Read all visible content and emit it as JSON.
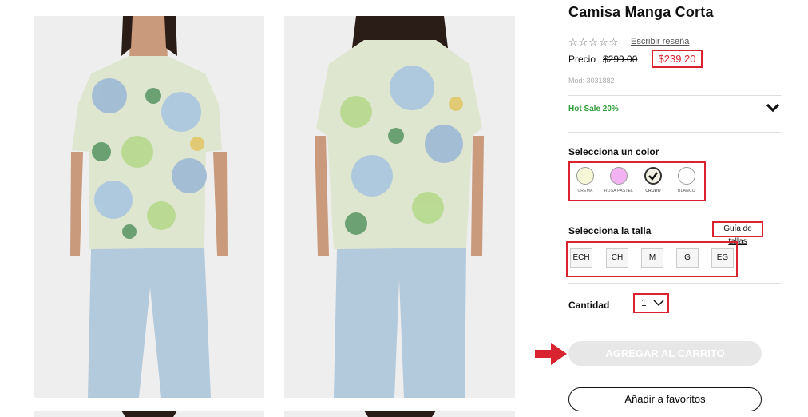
{
  "product": {
    "title": "Camisa Manga Corta",
    "stars": "☆☆☆☆☆",
    "review_link": "Escribir reseña",
    "price_label": "Precio",
    "price_old": "$299.00",
    "price_new": "$239.20",
    "model": "Mod: 3031882"
  },
  "promo": {
    "label": "Hot Sale 20%",
    "icon": "chevron-down-icon"
  },
  "colors": {
    "label": "Selecciona un color",
    "options": [
      {
        "name": "CREMA",
        "hex": "#f5f7d6"
      },
      {
        "name": "ROSA PASTEL",
        "hex": "#f3b3f2"
      },
      {
        "name": "CRUDO",
        "hex": "#f2f0e2",
        "selected": true
      },
      {
        "name": "BLANCO",
        "hex": "#ffffff"
      }
    ]
  },
  "sizes": {
    "label": "Selecciona la talla",
    "guide_link": "Guía de tallas",
    "options": [
      "ECH",
      "CH",
      "M",
      "G",
      "EG"
    ]
  },
  "quantity": {
    "label": "Cantidad",
    "value": "1"
  },
  "actions": {
    "add_to_cart": "AGREGAR AL CARRITO",
    "add_to_favorites": "Añadir a favoritos"
  },
  "colors_theme": {
    "highlight": "#d9232e",
    "promo": "#2e9e3a"
  }
}
